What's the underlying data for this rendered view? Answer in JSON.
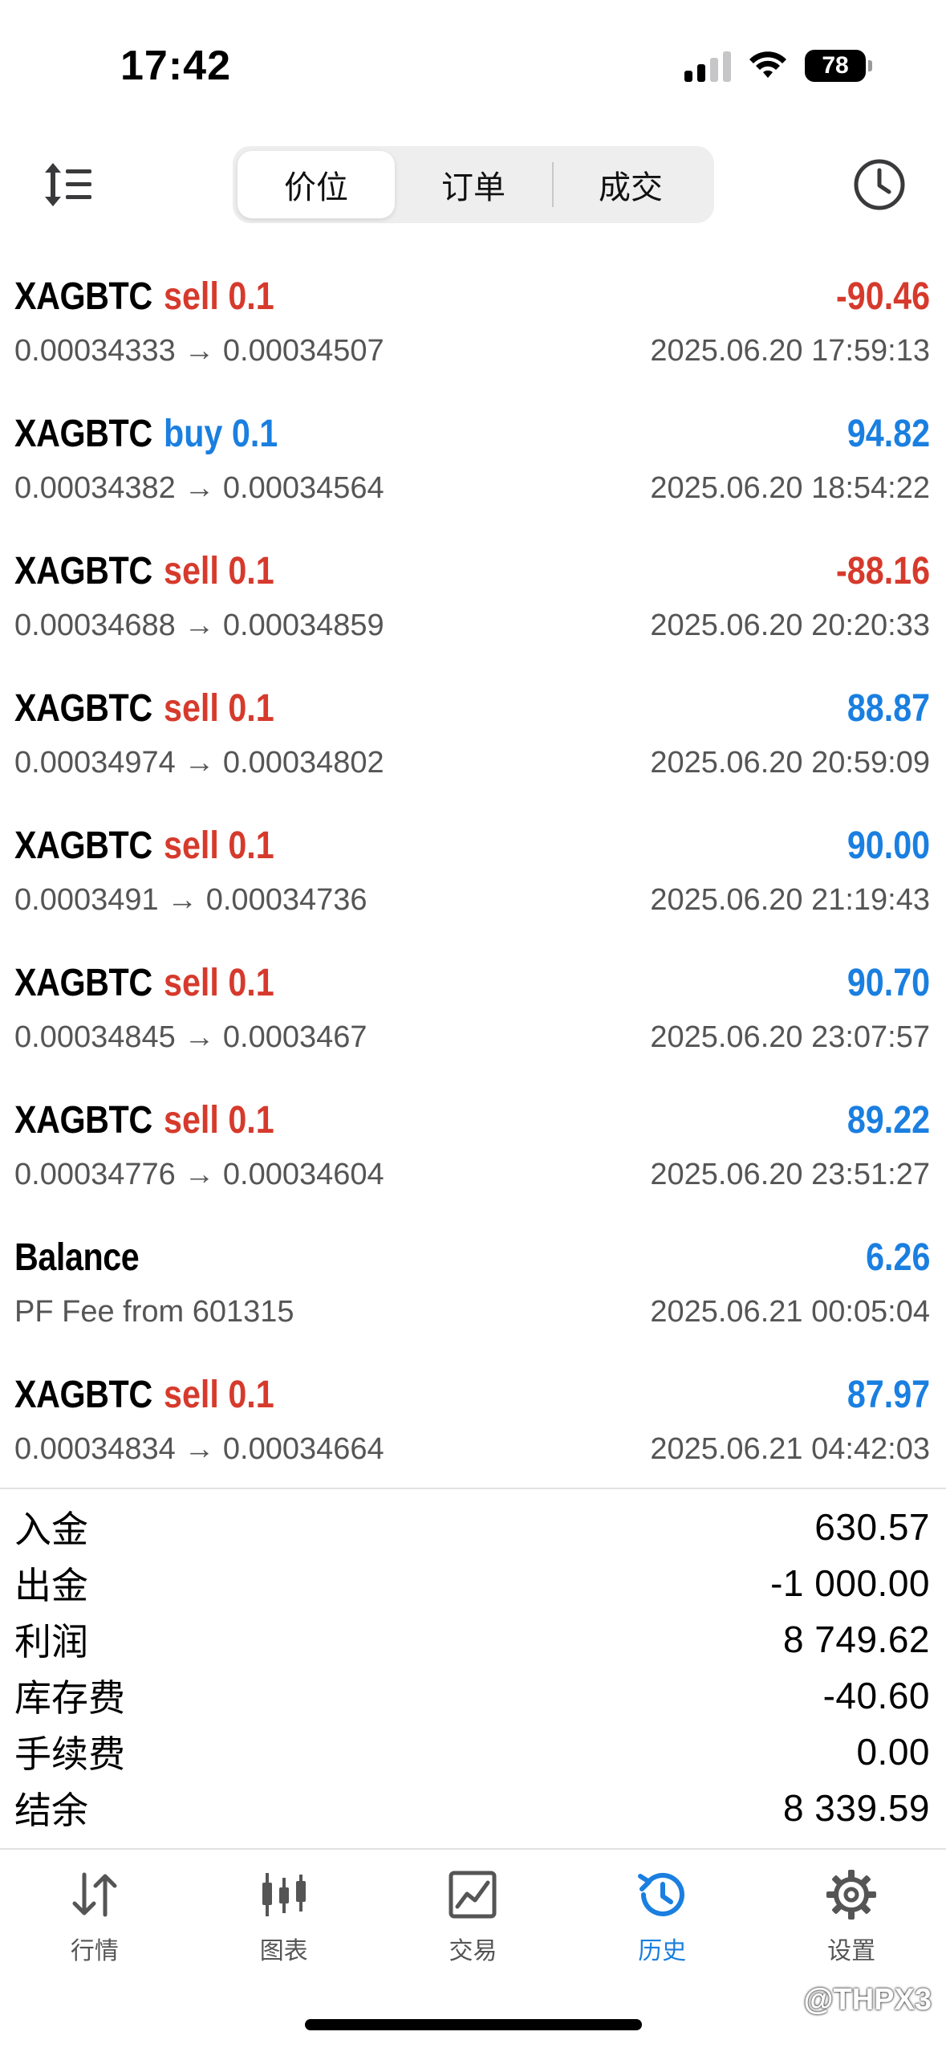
{
  "status": {
    "time": "17:42",
    "battery": "78"
  },
  "segments": [
    {
      "label": "价位",
      "active": true
    },
    {
      "label": "订单",
      "active": false
    },
    {
      "label": "成交",
      "active": false
    }
  ],
  "deals": [
    {
      "symbol": "XAGBTC",
      "side": "sell 0.1",
      "profit": "-90.46",
      "prices": "0.00034333 → 0.00034507",
      "time": "2025.06.20 17:59:13"
    },
    {
      "symbol": "XAGBTC",
      "side": "buy 0.1",
      "profit": "94.82",
      "prices": "0.00034382 → 0.00034564",
      "time": "2025.06.20 18:54:22"
    },
    {
      "symbol": "XAGBTC",
      "side": "sell 0.1",
      "profit": "-88.16",
      "prices": "0.00034688 → 0.00034859",
      "time": "2025.06.20 20:20:33"
    },
    {
      "symbol": "XAGBTC",
      "side": "sell 0.1",
      "profit": "88.87",
      "prices": "0.00034974 → 0.00034802",
      "time": "2025.06.20 20:59:09"
    },
    {
      "symbol": "XAGBTC",
      "side": "sell 0.1",
      "profit": "90.00",
      "prices": "0.0003491 → 0.00034736",
      "time": "2025.06.20 21:19:43"
    },
    {
      "symbol": "XAGBTC",
      "side": "sell 0.1",
      "profit": "90.70",
      "prices": "0.00034845 → 0.0003467",
      "time": "2025.06.20 23:07:57"
    },
    {
      "symbol": "XAGBTC",
      "side": "sell 0.1",
      "profit": "89.22",
      "prices": "0.00034776 → 0.00034604",
      "time": "2025.06.20 23:51:27"
    },
    {
      "symbol": "Balance",
      "side": "",
      "profit": "6.26",
      "prices": "PF Fee from 601315",
      "time": "2025.06.21 00:05:04"
    },
    {
      "symbol": "XAGBTC",
      "side": "sell 0.1",
      "profit": "87.97",
      "prices": "0.00034834 → 0.00034664",
      "time": "2025.06.21 04:42:03"
    }
  ],
  "summary": [
    {
      "label": "入金",
      "value": "630.57"
    },
    {
      "label": "出金",
      "value": "-1 000.00"
    },
    {
      "label": "利润",
      "value": "8 749.62"
    },
    {
      "label": "库存费",
      "value": "-40.60"
    },
    {
      "label": "手续费",
      "value": "0.00"
    },
    {
      "label": "结余",
      "value": "8 339.59"
    }
  ],
  "tabs": [
    {
      "label": "行情",
      "icon": "quotes-icon",
      "active": false
    },
    {
      "label": "图表",
      "icon": "chart-icon",
      "active": false
    },
    {
      "label": "交易",
      "icon": "trade-icon",
      "active": false
    },
    {
      "label": "历史",
      "icon": "history-icon",
      "active": true
    },
    {
      "label": "设置",
      "icon": "settings-icon",
      "active": false
    }
  ],
  "watermark": "@THPX3",
  "colors": {
    "sell": "#d63a2c",
    "buy": "#1a7fe0",
    "accent": "#1a7fe0"
  }
}
